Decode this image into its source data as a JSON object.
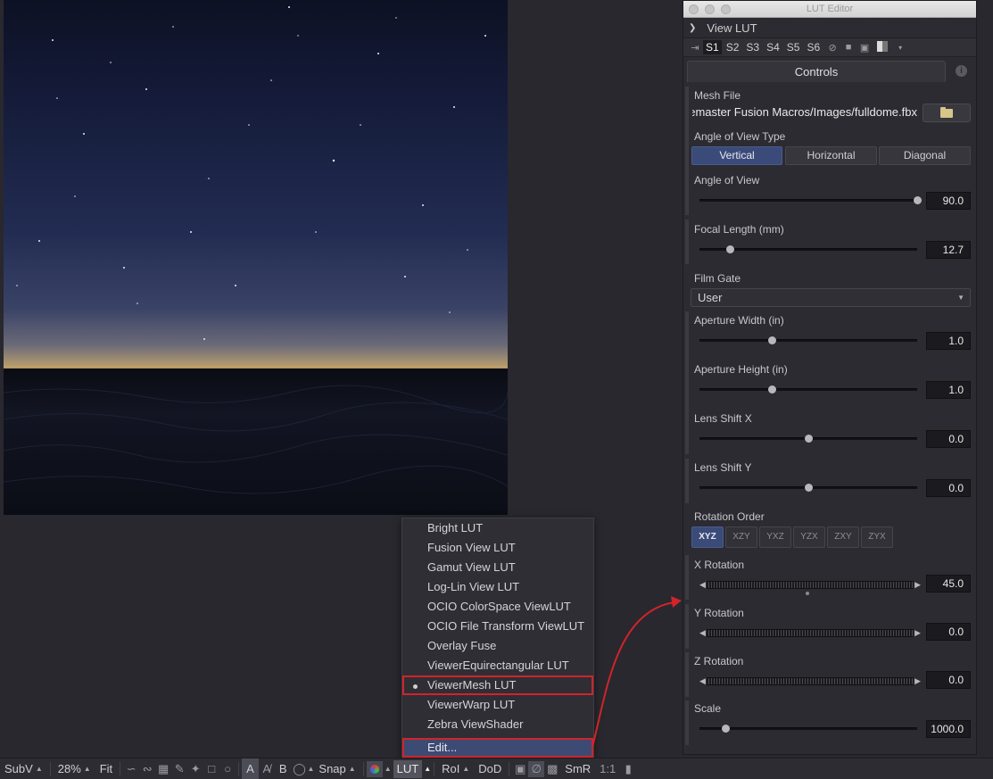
{
  "viewer": {
    "zoom": "28%"
  },
  "toolbar": {
    "subv": "SubV",
    "zoom": "28%",
    "fit": "Fit",
    "a": "A",
    "b": "B",
    "snap": "Snap",
    "lut": "LUT",
    "roi": "RoI",
    "dod": "DoD",
    "smr": "SmR",
    "ratio": "1:1"
  },
  "menu": {
    "items": [
      "Bright LUT",
      "Fusion View LUT",
      "Gamut View LUT",
      "Log-Lin View LUT",
      "OCIO ColorSpace ViewLUT",
      "OCIO File Transform ViewLUT",
      "Overlay Fuse",
      "ViewerEquirectangular LUT",
      "ViewerMesh LUT",
      "ViewerWarp LUT",
      "Zebra ViewShader"
    ],
    "selected": "ViewerMesh LUT",
    "edit": "Edit..."
  },
  "editor": {
    "window_title": "LUT Editor",
    "section": "View LUT",
    "slots": [
      "S1",
      "S2",
      "S3",
      "S4",
      "S5",
      "S6"
    ],
    "active_slot": "S1",
    "tab": "Controls",
    "mesh_file_label": "Mesh File",
    "mesh_file_value": "emaster Fusion Macros/Images/fulldome.fbx",
    "aov_type_label": "Angle of View Type",
    "aov_types": [
      "Vertical",
      "Horizontal",
      "Diagonal"
    ],
    "aov_type_selected": "Vertical",
    "angle_of_view": {
      "label": "Angle of View",
      "value": "90.0",
      "fraction": 1.0
    },
    "focal_length": {
      "label": "Focal Length (mm)",
      "value": "12.7",
      "fraction": 0.14
    },
    "film_gate": {
      "label": "Film Gate",
      "value": "User"
    },
    "aperture_width": {
      "label": "Aperture Width (in)",
      "value": "1.0",
      "fraction": 0.33
    },
    "aperture_height": {
      "label": "Aperture Height (in)",
      "value": "1.0",
      "fraction": 0.33
    },
    "lens_shift_x": {
      "label": "Lens Shift X",
      "value": "0.0",
      "fraction": 0.5
    },
    "lens_shift_y": {
      "label": "Lens Shift Y",
      "value": "0.0",
      "fraction": 0.5
    },
    "rotation_order_label": "Rotation Order",
    "rotation_orders": [
      "XYZ",
      "XZY",
      "YXZ",
      "YZX",
      "ZXY",
      "ZYX"
    ],
    "rotation_order_selected": "XYZ",
    "x_rotation": {
      "label": "X Rotation",
      "value": "45.0"
    },
    "y_rotation": {
      "label": "Y Rotation",
      "value": "0.0"
    },
    "z_rotation": {
      "label": "Z Rotation",
      "value": "0.0"
    },
    "scale": {
      "label": "Scale",
      "value": "1000.0",
      "fraction": 0.12
    }
  },
  "colors": {
    "highlight_red": "#d0242a",
    "accent_blue": "#3b4b79"
  }
}
